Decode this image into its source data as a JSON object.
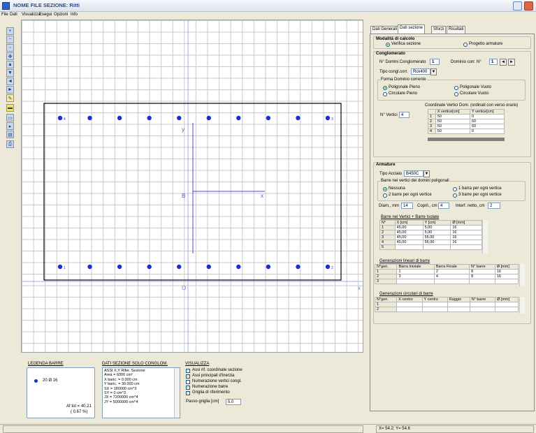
{
  "window": {
    "title": "NOME FILE SEZIONE:  Ritti"
  },
  "menu": [
    "File",
    "Dati",
    "Visualizza",
    "Esegui",
    "Opzioni",
    "Info"
  ],
  "toolbar": {
    "tools": [
      "zoom-in",
      "zoom-out",
      "zoom-window",
      "pan",
      "line-up",
      "line-down",
      "line-left",
      "line-right",
      "pencil",
      "rectangle",
      "fill",
      "arrow",
      "document",
      "print"
    ]
  },
  "canvas": {
    "axis_y_label": "y",
    "axis_x_label": "x",
    "center_label": "B",
    "origin_label": "O",
    "right_label": "x",
    "top_row_first_label": "4",
    "top_row_last_label": "3",
    "bottom_row_first_label": "1",
    "bottom_row_last_label": "2"
  },
  "legend": {
    "title": "LEGENDA BARRE",
    "item": "20 Ø 16",
    "af_tot": "Af tot = 40.21",
    "af_pct": "( 0.67 %)"
  },
  "section_data": {
    "title": "DATI SEZIONE SOLO CONGLOM.",
    "lines": [
      "ASSI X,Y   Rifer. Sezione",
      "Area = 6000 cm²",
      "X baric. = 0.000 cm",
      "Y baric. = 30.000 cm",
      "SX = 180000 cm^3",
      "SY = 0 cm^3",
      "JX = 7200000 cm^4",
      "JY = 5000000 cm^4"
    ]
  },
  "display": {
    "title": "VISUALIZZA",
    "options": [
      {
        "label": "Assi rif. coordinate sezione",
        "checked": true
      },
      {
        "label": "Assi principali d'inerzia",
        "checked": true
      },
      {
        "label": "Numerazione vertici congl.",
        "checked": false
      },
      {
        "label": "Numerazione barre",
        "checked": true
      },
      {
        "label": "Griglia di riferimento",
        "checked": true
      }
    ],
    "grid_step_label": "Passo griglia [cm]",
    "grid_step_value": "5.0"
  },
  "tabs": [
    "Dati Generali",
    "Dati sezione",
    "Sforzi",
    "Risultati"
  ],
  "calc_mode": {
    "title": "Modalità di calcolo",
    "opt1": "Verifica sezione",
    "opt2": "Progetto armature"
  },
  "concrete": {
    "title": "Conglomerato",
    "domain_count_label": "N° Domini Conglomerato",
    "domain_count": "1",
    "domain_cur_label": "Dominio corr. N°",
    "domain_cur": "1",
    "type_label": "Tipo congl.corr.",
    "type_value": "Rck400",
    "shape_group": "Forma Dominio corrente",
    "shape1": "Poligonale Pieno",
    "shape2": "Poligonale Vuoto",
    "shape3": "Circolare Pieno",
    "shape4": "Circolare Vuoto",
    "coords_title": "Coordinate Vertici Dom. (ordinati con verso orario)",
    "vertices_label": "N° Vertici",
    "vertices": "4",
    "cols": [
      "",
      "X vertice[cm]",
      "Y vertice[cm]"
    ],
    "rows": [
      [
        "1",
        "50",
        "0"
      ],
      [
        "2",
        "50",
        "60"
      ],
      [
        "3",
        "50",
        "60"
      ],
      [
        "4",
        "50",
        "0"
      ]
    ]
  },
  "rebar": {
    "title": "Armature",
    "steel_label": "Tipo Acciaio",
    "steel_value": "B450C",
    "vertex_group": "Barre nei vertici dei domini poligonali",
    "opt_none": "Nessuna",
    "opt_one": "1 barra per ogni vertice",
    "opt_two": "2 barre per ogni vertice",
    "opt_three": "3 barre per ogni vertice",
    "diam_label": "Diam., mm",
    "diam_value": "14",
    "cover_label": "Copril., cm",
    "cover_value": "4",
    "spacing_label": "Interf. netto, cm",
    "spacing_value": "2",
    "iso_title": "Barre nei Vertici + Barre Isolate",
    "iso_cols": [
      "N°",
      "X [cm]",
      "Y [cm]",
      "Ø [mm]"
    ],
    "iso_rows": [
      [
        "1",
        "45,00",
        "5,00",
        "16"
      ],
      [
        "2",
        "45,00",
        "5,00",
        "16"
      ],
      [
        "3",
        "45,00",
        "55,00",
        "16"
      ],
      [
        "4",
        "45,00",
        "55,00",
        "16"
      ],
      [
        "5",
        "",
        "",
        ""
      ]
    ],
    "lin_title": "Generazioni lineari di barre",
    "lin_cols": [
      "N°gen.",
      "Barra Iniziale",
      "Barra Finale",
      "N° barre",
      "Ø [mm]"
    ],
    "lin_rows": [
      [
        "1",
        "1",
        "2",
        "8",
        "16"
      ],
      [
        "2",
        "3",
        "4",
        "8",
        "16"
      ],
      [
        "3",
        "",
        "",
        "",
        ""
      ]
    ],
    "circ_title": "Generazioni circolari di barre",
    "circ_cols": [
      "N°gen.",
      "X centro",
      "Y centro",
      "Raggio",
      "N° barre",
      "Ø [mm]"
    ],
    "circ_rows": [
      [
        "1",
        "",
        "",
        "",
        "",
        ""
      ],
      [
        "2",
        "",
        "",
        "",
        "",
        ""
      ]
    ]
  },
  "status": {
    "coords": "X=  54.2;  Y=  54.6"
  },
  "colors": {
    "accent": "#1a2fd0",
    "axis": "#9a9af0",
    "frame": "#000000"
  }
}
